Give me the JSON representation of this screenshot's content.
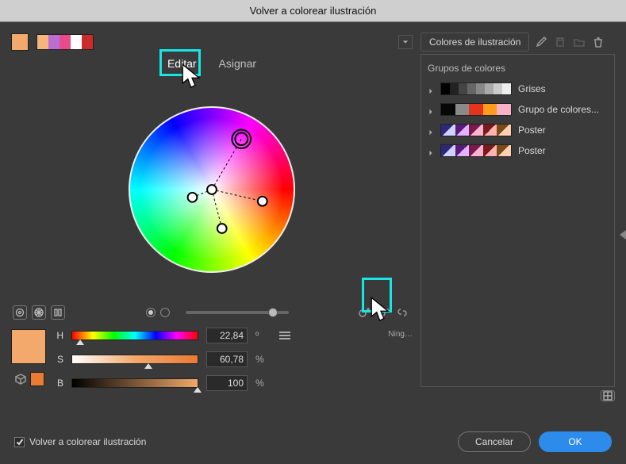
{
  "title": "Volver a colorear ilustración",
  "accent": "#2d8ceb",
  "highlight": "#17E6E6",
  "topstrip": {
    "main_swatch": "#f2a96b",
    "mini_swatches": [
      "#f6b57a",
      "#bb6ed1",
      "#e94b8a",
      "#ffffff",
      "#cc2b2b"
    ],
    "illustration_colors_label": "Colores de ilustración"
  },
  "tabs": {
    "edit": "Editar",
    "assign": "Asignar",
    "active": "edit"
  },
  "wheel": {
    "brightness_slider_pos": 0.8,
    "radio_selected": 1
  },
  "link_tooltip": "Ning…",
  "hsb": {
    "big_swatch": "#f2a96b",
    "cube_swatch": "#eb7a35",
    "H": {
      "value": "22,84",
      "unit": "º",
      "pos": 0.063
    },
    "S": {
      "value": "60,78",
      "unit": "%",
      "pos": 0.608
    },
    "B": {
      "value": "100",
      "unit": "%",
      "pos": 1.0
    }
  },
  "right": {
    "header": "Grupos de colores",
    "groups": [
      {
        "label": "Grises",
        "ramp": [
          "#000000",
          "#222",
          "#444",
          "#666",
          "#888",
          "#aaa",
          "#ccc",
          "#eee"
        ]
      },
      {
        "label": "Grupo de colores...",
        "ramp": [
          "#070707",
          "#8a8a8a",
          "#e3341f",
          "#ff9c1b",
          "#f7b2c7"
        ]
      },
      {
        "label": "Poster",
        "ramp": [
          "#2a2a7a/#d1d1ff",
          "#5a1a7a/#e3b2ff",
          "#7a1a4a/#ffb2d1",
          "#7a1a1a/#ffb2b2",
          "#7a4a1a/#ffd1b2"
        ]
      },
      {
        "label": "Poster",
        "ramp": [
          "#2a2a7a/#d1d1ff",
          "#5a1a7a/#e3b2ff",
          "#7a1a4a/#ffb2d1",
          "#7a1a1a/#ffb2b2",
          "#7a4a1a/#ffd1b2"
        ]
      }
    ]
  },
  "footer": {
    "checkbox_label": "Volver a colorear ilustración",
    "checkbox_checked": true,
    "cancel": "Cancelar",
    "ok": "OK"
  }
}
